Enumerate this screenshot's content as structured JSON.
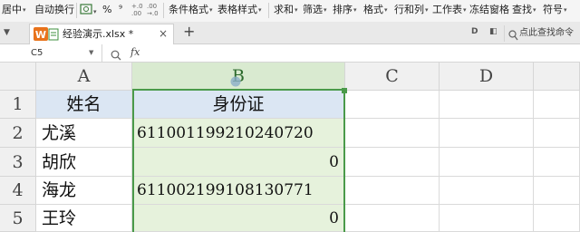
{
  "ribbon": {
    "merge_center": "居中",
    "wrap_text": "自动换行",
    "percent": "%",
    "comma": "⁹",
    "dec_inc": "+.0",
    "dec_inc2": ".00",
    "dec_dec": ".00",
    "dec_dec2": "→.0",
    "conditional_format": "条件格式",
    "table_style": "表格样式",
    "sum": "求和",
    "filter": "筛选",
    "sort": "排序",
    "format": "格式",
    "row_col": "行和列",
    "worksheet": "工作表",
    "freeze": "冻结窗格",
    "find": "查找",
    "symbol": "符号"
  },
  "tabs": {
    "file_name": "经验演示.xlsx *",
    "add_tab": "+",
    "search_cmd": "点此查找命令"
  },
  "formula_bar": {
    "name_box": "C5",
    "fx": "fx",
    "content": ""
  },
  "columns": [
    "A",
    "B",
    "C",
    "D"
  ],
  "rows": [
    "1",
    "2",
    "3",
    "4",
    "5"
  ],
  "cells": {
    "A1": "姓名",
    "B1": "身份证",
    "A2": "尤溪",
    "B2": "611001199210240720",
    "A3": "胡欣",
    "B3": "0",
    "A4": "海龙",
    "B4": "611002199108130771",
    "A5": "王玲",
    "B5": "0"
  },
  "colors": {
    "accent_green": "#4a9a4a",
    "selected_fill": "#e6f2dc",
    "header_fill": "#dbe6f3"
  }
}
